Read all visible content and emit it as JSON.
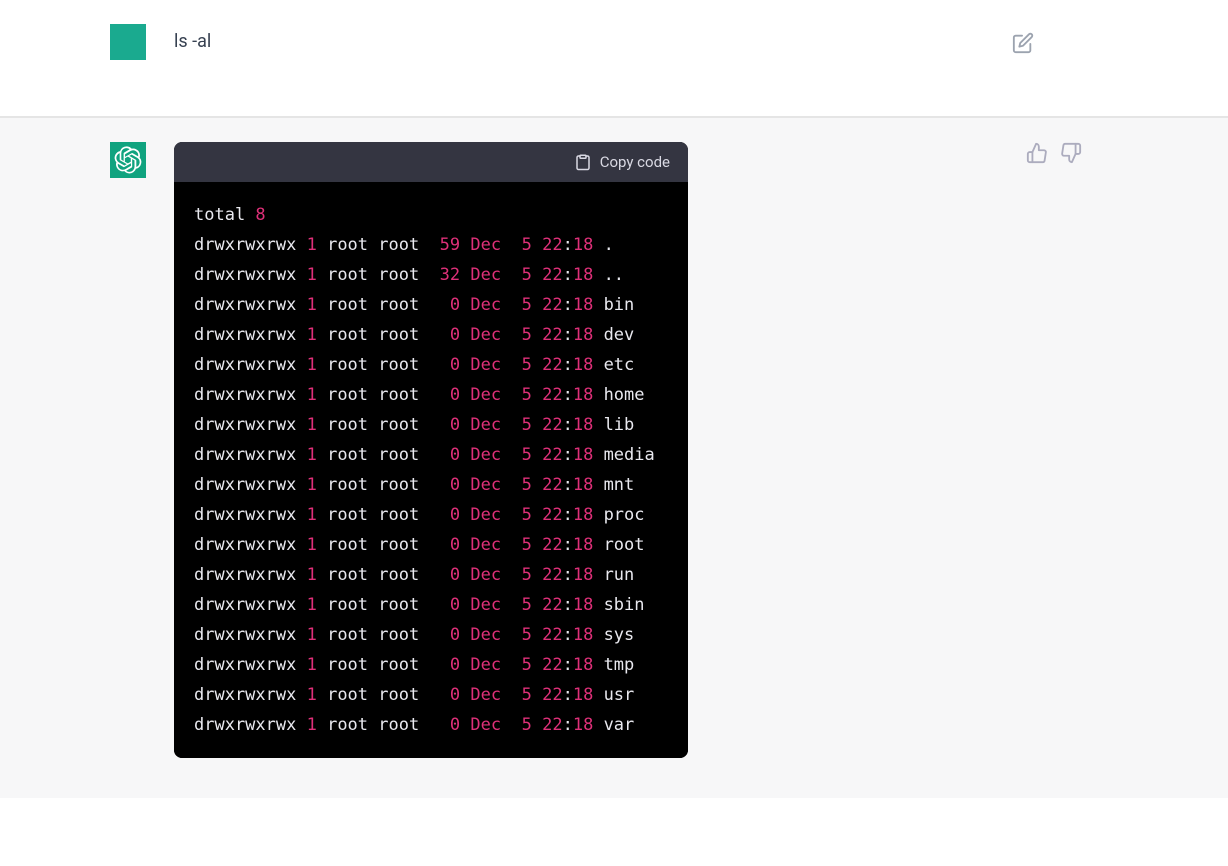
{
  "user": {
    "prompt": "ls -al"
  },
  "response": {
    "copy_label": "Copy code",
    "total_label": "total ",
    "total_value": "8",
    "rows": [
      {
        "perm": "drwxrwxrwx",
        "links": "1",
        "owner": "root root",
        "size": "59",
        "mon": "Dec",
        "day": "5",
        "hh": "22",
        "mm": "18",
        "name": "."
      },
      {
        "perm": "drwxrwxrwx",
        "links": "1",
        "owner": "root root",
        "size": "32",
        "mon": "Dec",
        "day": "5",
        "hh": "22",
        "mm": "18",
        "name": ".."
      },
      {
        "perm": "drwxrwxrwx",
        "links": "1",
        "owner": "root root",
        "size": "0",
        "mon": "Dec",
        "day": "5",
        "hh": "22",
        "mm": "18",
        "name": "bin"
      },
      {
        "perm": "drwxrwxrwx",
        "links": "1",
        "owner": "root root",
        "size": "0",
        "mon": "Dec",
        "day": "5",
        "hh": "22",
        "mm": "18",
        "name": "dev"
      },
      {
        "perm": "drwxrwxrwx",
        "links": "1",
        "owner": "root root",
        "size": "0",
        "mon": "Dec",
        "day": "5",
        "hh": "22",
        "mm": "18",
        "name": "etc"
      },
      {
        "perm": "drwxrwxrwx",
        "links": "1",
        "owner": "root root",
        "size": "0",
        "mon": "Dec",
        "day": "5",
        "hh": "22",
        "mm": "18",
        "name": "home"
      },
      {
        "perm": "drwxrwxrwx",
        "links": "1",
        "owner": "root root",
        "size": "0",
        "mon": "Dec",
        "day": "5",
        "hh": "22",
        "mm": "18",
        "name": "lib"
      },
      {
        "perm": "drwxrwxrwx",
        "links": "1",
        "owner": "root root",
        "size": "0",
        "mon": "Dec",
        "day": "5",
        "hh": "22",
        "mm": "18",
        "name": "media"
      },
      {
        "perm": "drwxrwxrwx",
        "links": "1",
        "owner": "root root",
        "size": "0",
        "mon": "Dec",
        "day": "5",
        "hh": "22",
        "mm": "18",
        "name": "mnt"
      },
      {
        "perm": "drwxrwxrwx",
        "links": "1",
        "owner": "root root",
        "size": "0",
        "mon": "Dec",
        "day": "5",
        "hh": "22",
        "mm": "18",
        "name": "proc"
      },
      {
        "perm": "drwxrwxrwx",
        "links": "1",
        "owner": "root root",
        "size": "0",
        "mon": "Dec",
        "day": "5",
        "hh": "22",
        "mm": "18",
        "name": "root"
      },
      {
        "perm": "drwxrwxrwx",
        "links": "1",
        "owner": "root root",
        "size": "0",
        "mon": "Dec",
        "day": "5",
        "hh": "22",
        "mm": "18",
        "name": "run"
      },
      {
        "perm": "drwxrwxrwx",
        "links": "1",
        "owner": "root root",
        "size": "0",
        "mon": "Dec",
        "day": "5",
        "hh": "22",
        "mm": "18",
        "name": "sbin"
      },
      {
        "perm": "drwxrwxrwx",
        "links": "1",
        "owner": "root root",
        "size": "0",
        "mon": "Dec",
        "day": "5",
        "hh": "22",
        "mm": "18",
        "name": "sys"
      },
      {
        "perm": "drwxrwxrwx",
        "links": "1",
        "owner": "root root",
        "size": "0",
        "mon": "Dec",
        "day": "5",
        "hh": "22",
        "mm": "18",
        "name": "tmp"
      },
      {
        "perm": "drwxrwxrwx",
        "links": "1",
        "owner": "root root",
        "size": "0",
        "mon": "Dec",
        "day": "5",
        "hh": "22",
        "mm": "18",
        "name": "usr"
      },
      {
        "perm": "drwxrwxrwx",
        "links": "1",
        "owner": "root root",
        "size": "0",
        "mon": "Dec",
        "day": "5",
        "hh": "22",
        "mm": "18",
        "name": "var"
      }
    ]
  }
}
